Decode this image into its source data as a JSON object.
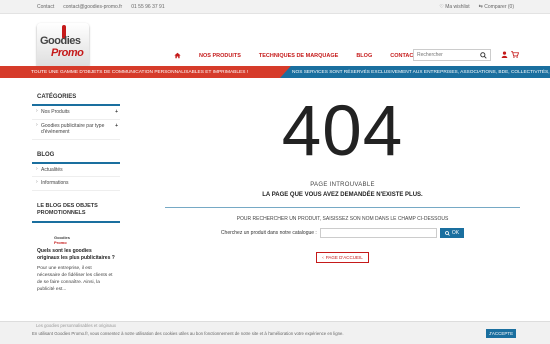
{
  "topbar": {
    "contact": "Contact",
    "email": "contact@goodies-promo.fr",
    "phone": "01 55 96 37 91",
    "wishlist": "Ma wishlist",
    "compare": "Comparer (0)"
  },
  "logo": {
    "line1": "Goodies",
    "line2": "Promo"
  },
  "nav": {
    "items": [
      "NOS PRODUITS",
      "TECHNIQUES DE MARQUAGE",
      "BLOG",
      "CONTACT"
    ]
  },
  "search": {
    "placeholder": "Rechercher"
  },
  "banner": {
    "left": "TOUTE UNE GAMME D'OBJETS DE COMMUNICATION PERSONNALISABLES ET IMPRIMABLES !",
    "right": "NOS SERVICES SONT RÉSERVÉS EXCLUSIVEMENT AUX ENTREPRISES, ASSOCIATIONS, BDE, COLLECTIVITÉS, ..."
  },
  "sidebar": {
    "categories_title": "CATÉGORIES",
    "categories": [
      "Nos Produits",
      "Goodies publicitaire par type d'événement"
    ],
    "blog_title": "BLOG",
    "blog_items": [
      "Actualités",
      "Informations"
    ],
    "promo_blog_title": "LE BLOG DES OBJETS PROMOTIONNELS",
    "post_title": "Quels sont les goodies originaux les plus publicitaires ?",
    "post_body": "Pour une entreprise, il est nécessaire de fidéliser les clients et de se faire connaître. Ainsi, la publicité est..."
  },
  "main": {
    "code": "404",
    "title": "PAGE INTROUVABLE",
    "subtitle": "LA PAGE QUE VOUS AVEZ DEMANDÉE N'EXISTE PLUS.",
    "hint": "POUR RECHERCHER UN PRODUIT, SAISISSEZ SON NOM DANS LE CHAMP CI-DESSOUS",
    "search_label": "Cherchez un produit dans notre catalogue :",
    "ok_label": "OK",
    "back_label": "PAGE D'ACCUEIL"
  },
  "cookie": {
    "ghost": "Les goodies personnalisables et originaux",
    "text": "En utilisant Goodies Promo.fr, vous consentez à notre utilisation des cookies utiles au bon fonctionnement de notre site et à l'amélioration votre expérience en ligne.",
    "accept": "J'ACCEPTE"
  },
  "colors": {
    "brand_red": "#c51a1a",
    "brand_blue": "#1a6f9f",
    "banner_red": "#d63b2a"
  }
}
